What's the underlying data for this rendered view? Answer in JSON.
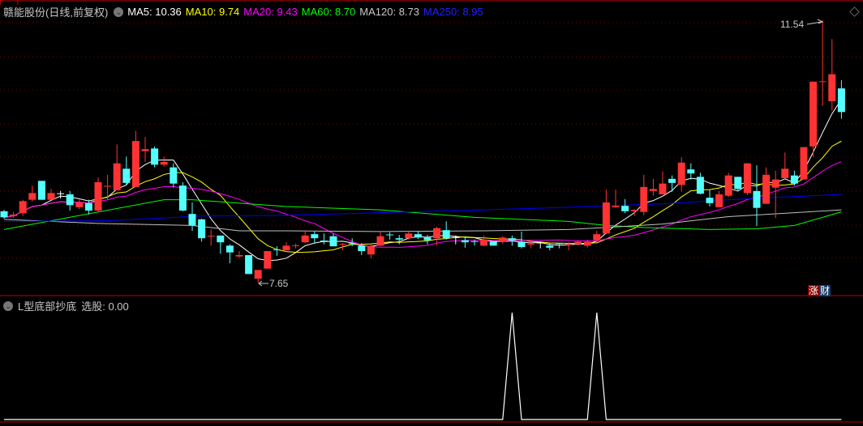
{
  "header": {
    "stock_name": "赣能股份(日线,前复权)",
    "indicators": [
      {
        "label": "MA5: 10.36",
        "color": "#ffffff"
      },
      {
        "label": "MA10: 9.74",
        "color": "#ffff00"
      },
      {
        "label": "MA20: 9.43",
        "color": "#ff00ff"
      },
      {
        "label": "MA60: 8.70",
        "color": "#00ff00"
      },
      {
        "label": "MA120: 8.73",
        "color": "#c8c8c8"
      },
      {
        "label": "MA250: 8.95",
        "color": "#2020ff"
      }
    ]
  },
  "indicator_panel": {
    "name": "L型底部抄底",
    "value_label": "选股: 0.00"
  },
  "annotations": {
    "high_label": "11.54",
    "low_label": "7.65"
  },
  "badge": {
    "left": "涨",
    "right": "财"
  },
  "chart_data": {
    "type": "candlestick",
    "price_range": [
      7.65,
      11.54
    ],
    "colors": {
      "up": "#ff3333",
      "down": "#54ffff",
      "flat": "#ffffff",
      "grid": "#7a0000"
    },
    "ohlc": [
      [
        8.71,
        8.73,
        8.6,
        8.62
      ],
      [
        8.64,
        8.7,
        8.61,
        8.66
      ],
      [
        8.68,
        8.88,
        8.64,
        8.86
      ],
      [
        8.88,
        9.09,
        8.85,
        8.98
      ],
      [
        9.16,
        9.16,
        8.88,
        8.88
      ],
      [
        8.88,
        9.04,
        8.88,
        8.98
      ],
      [
        8.97,
        9.01,
        8.9,
        8.97
      ],
      [
        8.96,
        9.01,
        8.72,
        8.8
      ],
      [
        8.77,
        8.88,
        8.74,
        8.84
      ],
      [
        8.83,
        8.88,
        8.66,
        8.72
      ],
      [
        8.72,
        9.21,
        8.7,
        9.14
      ],
      [
        9.07,
        9.25,
        8.88,
        9.08
      ],
      [
        9.02,
        9.7,
        9.02,
        9.42
      ],
      [
        9.34,
        9.52,
        9.1,
        9.13
      ],
      [
        9.07,
        9.9,
        9.07,
        9.75
      ],
      [
        9.6,
        9.81,
        9.44,
        9.63
      ],
      [
        9.64,
        9.67,
        9.36,
        9.4
      ],
      [
        9.4,
        9.52,
        9.37,
        9.44
      ],
      [
        9.36,
        9.42,
        9.06,
        9.12
      ],
      [
        9.09,
        9.14,
        8.71,
        8.72
      ],
      [
        8.67,
        8.84,
        8.42,
        8.5
      ],
      [
        8.59,
        8.6,
        8.26,
        8.31
      ],
      [
        8.33,
        8.44,
        8.2,
        8.34
      ],
      [
        8.35,
        8.35,
        8.08,
        8.25
      ],
      [
        8.2,
        8.22,
        7.94,
        8.1
      ],
      [
        8.04,
        8.12,
        8.02,
        8.06
      ],
      [
        8.06,
        8.06,
        7.78,
        7.78
      ],
      [
        7.71,
        7.84,
        7.65,
        7.84
      ],
      [
        7.86,
        8.12,
        7.86,
        8.12
      ],
      [
        8.14,
        8.19,
        8.05,
        8.13
      ],
      [
        8.13,
        8.25,
        8.13,
        8.2
      ],
      [
        8.19,
        8.23,
        8.16,
        8.2
      ],
      [
        8.25,
        8.43,
        8.24,
        8.35
      ],
      [
        8.37,
        8.41,
        8.24,
        8.31
      ],
      [
        8.27,
        8.38,
        8.22,
        8.26
      ],
      [
        8.34,
        8.38,
        8.19,
        8.19
      ],
      [
        8.21,
        8.24,
        8.13,
        8.22
      ],
      [
        8.23,
        8.31,
        8.19,
        8.22
      ],
      [
        8.2,
        8.24,
        8.06,
        8.12
      ],
      [
        8.07,
        8.22,
        8.01,
        8.19
      ],
      [
        8.2,
        8.41,
        8.19,
        8.34
      ],
      [
        8.36,
        8.4,
        8.29,
        8.35
      ],
      [
        8.31,
        8.36,
        8.22,
        8.29
      ],
      [
        8.31,
        8.41,
        8.29,
        8.38
      ],
      [
        8.37,
        8.41,
        8.3,
        8.32
      ],
      [
        8.32,
        8.36,
        8.22,
        8.28
      ],
      [
        8.31,
        8.48,
        8.2,
        8.46
      ],
      [
        8.43,
        8.56,
        8.29,
        8.31
      ],
      [
        8.32,
        8.35,
        8.22,
        8.32
      ],
      [
        8.28,
        8.34,
        8.17,
        8.25
      ],
      [
        8.26,
        8.29,
        8.2,
        8.25
      ],
      [
        8.2,
        8.35,
        8.19,
        8.29
      ],
      [
        8.26,
        8.26,
        8.2,
        8.2
      ],
      [
        8.26,
        8.34,
        8.23,
        8.32
      ],
      [
        8.31,
        8.35,
        8.2,
        8.28
      ],
      [
        8.26,
        8.41,
        8.16,
        8.18
      ],
      [
        8.21,
        8.29,
        8.17,
        8.22
      ],
      [
        8.24,
        8.26,
        8.16,
        8.24
      ],
      [
        8.2,
        8.24,
        8.13,
        8.17
      ],
      [
        8.23,
        8.24,
        8.16,
        8.22
      ],
      [
        8.21,
        8.25,
        8.13,
        8.22
      ],
      [
        8.22,
        8.28,
        8.2,
        8.26
      ],
      [
        8.2,
        8.29,
        8.17,
        8.26
      ],
      [
        8.28,
        8.42,
        8.25,
        8.37
      ],
      [
        8.38,
        9.03,
        8.37,
        8.84
      ],
      [
        8.77,
        9.03,
        8.76,
        8.79
      ],
      [
        8.79,
        8.89,
        8.68,
        8.71
      ],
      [
        8.71,
        8.74,
        8.64,
        8.73
      ],
      [
        8.7,
        9.25,
        8.65,
        9.07
      ],
      [
        9.01,
        9.19,
        8.94,
        9.04
      ],
      [
        8.96,
        9.3,
        8.96,
        9.12
      ],
      [
        9.19,
        9.24,
        9.0,
        9.13
      ],
      [
        9.1,
        9.51,
        9.0,
        9.43
      ],
      [
        9.33,
        9.42,
        9.18,
        9.27
      ],
      [
        9.22,
        9.28,
        8.96,
        8.97
      ],
      [
        8.91,
        9.03,
        8.78,
        8.83
      ],
      [
        8.77,
        9.01,
        8.77,
        8.96
      ],
      [
        8.94,
        9.28,
        8.92,
        9.24
      ],
      [
        9.22,
        9.22,
        9.02,
        9.04
      ],
      [
        8.98,
        9.42,
        8.95,
        9.42
      ],
      [
        9.01,
        9.39,
        8.49,
        8.76
      ],
      [
        8.82,
        9.36,
        8.82,
        9.25
      ],
      [
        9.06,
        9.31,
        8.61,
        9.18
      ],
      [
        9.2,
        9.58,
        9.2,
        9.34
      ],
      [
        9.24,
        9.31,
        9.09,
        9.12
      ],
      [
        9.18,
        9.66,
        9.18,
        9.66
      ],
      [
        9.67,
        10.63,
        9.51,
        10.63
      ],
      [
        10.62,
        11.54,
        10.27,
        10.63
      ],
      [
        10.34,
        11.26,
        10.2,
        10.74
      ],
      [
        10.53,
        10.65,
        10.08,
        10.18
      ]
    ],
    "moving_averages": [
      {
        "name": "MA5",
        "period": 5,
        "color": "#ffffff"
      },
      {
        "name": "MA10",
        "period": 10,
        "color": "#ffff00"
      },
      {
        "name": "MA20",
        "period": 20,
        "color": "#ff00ff"
      },
      {
        "name": "MA60",
        "color": "#00ff00",
        "points": [
          [
            0,
            8.44
          ],
          [
            17,
            8.88
          ],
          [
            20,
            8.88
          ],
          [
            30,
            8.78
          ],
          [
            40,
            8.73
          ],
          [
            50,
            8.62
          ],
          [
            60,
            8.56
          ],
          [
            64,
            8.5
          ],
          [
            68,
            8.47
          ],
          [
            75,
            8.44
          ],
          [
            80,
            8.45
          ],
          [
            84,
            8.5
          ],
          [
            89,
            8.7
          ]
        ]
      },
      {
        "name": "MA120",
        "color": "#c0c0c0",
        "points": [
          [
            0,
            8.59
          ],
          [
            10,
            8.53
          ],
          [
            20,
            8.5
          ],
          [
            25,
            8.42
          ],
          [
            30,
            8.42
          ],
          [
            40,
            8.41
          ],
          [
            51,
            8.42
          ],
          [
            60,
            8.44
          ],
          [
            64,
            8.47
          ],
          [
            70,
            8.52
          ],
          [
            77,
            8.63
          ],
          [
            89,
            8.73
          ]
        ]
      },
      {
        "name": "MA250",
        "color": "#0000ff",
        "points": [
          [
            0,
            8.56
          ],
          [
            11,
            8.57
          ],
          [
            17,
            8.61
          ],
          [
            21,
            8.64
          ],
          [
            30,
            8.65
          ],
          [
            43,
            8.7
          ],
          [
            51,
            8.73
          ],
          [
            60,
            8.77
          ],
          [
            64,
            8.79
          ],
          [
            70,
            8.82
          ],
          [
            77,
            8.88
          ],
          [
            89,
            8.96
          ]
        ]
      }
    ],
    "signal": {
      "name": "选股",
      "range": [
        0,
        1
      ],
      "hits": [
        54,
        63
      ]
    }
  }
}
